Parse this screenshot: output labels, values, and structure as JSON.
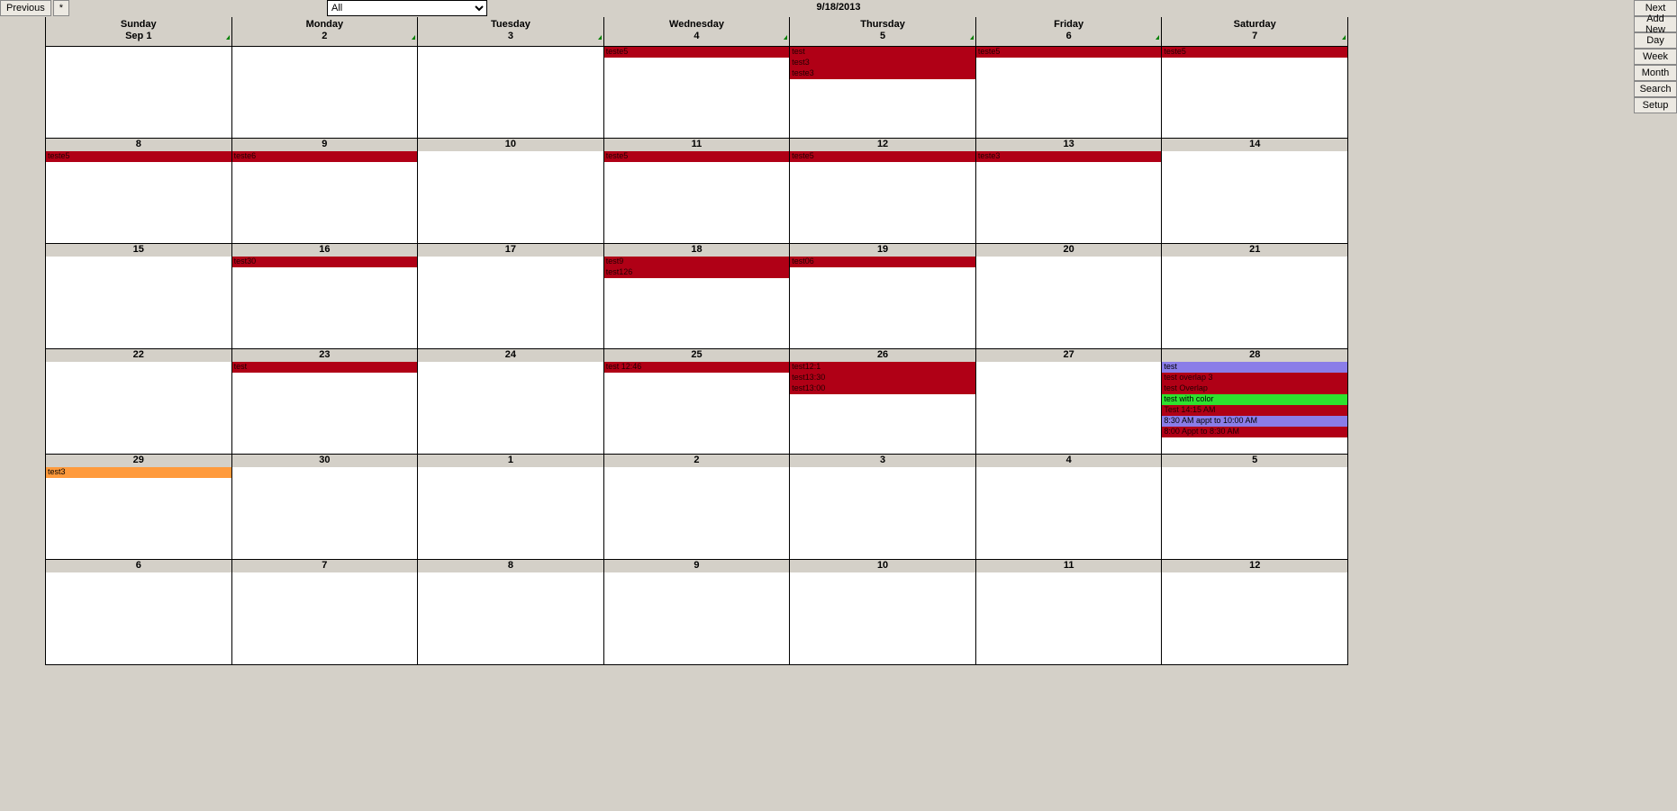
{
  "toolbar": {
    "previous": "Previous",
    "star": "*",
    "filter_selected": "All",
    "date": "9/18/2013",
    "next": "Next",
    "add_new": "Add New",
    "day": "Day",
    "week": "Week",
    "month": "Month",
    "search": "Search",
    "setup": "Setup"
  },
  "headers": [
    {
      "day": "Sunday",
      "sub": "Sep 1"
    },
    {
      "day": "Monday",
      "sub": "2"
    },
    {
      "day": "Tuesday",
      "sub": "3"
    },
    {
      "day": "Wednesday",
      "sub": "4"
    },
    {
      "day": "Thursday",
      "sub": "5"
    },
    {
      "day": "Friday",
      "sub": "6"
    },
    {
      "day": "Saturday",
      "sub": "7"
    }
  ],
  "weeks": [
    {
      "numbers": null,
      "days": [
        {
          "events": []
        },
        {
          "events": []
        },
        {
          "events": []
        },
        {
          "events": [
            {
              "text": "teste5",
              "cls": "ev-red"
            }
          ]
        },
        {
          "events": [
            {
              "text": "test",
              "cls": "ev-red"
            },
            {
              "text": "test3",
              "cls": "ev-red"
            },
            {
              "text": "teste3",
              "cls": "ev-red"
            }
          ]
        },
        {
          "events": [
            {
              "text": "teste5",
              "cls": "ev-red"
            }
          ]
        },
        {
          "events": [
            {
              "text": "teste5",
              "cls": "ev-red"
            }
          ]
        }
      ]
    },
    {
      "numbers": [
        "8",
        "9",
        "10",
        "11",
        "12",
        "13",
        "14"
      ],
      "days": [
        {
          "events": [
            {
              "text": "teste5",
              "cls": "ev-red"
            }
          ]
        },
        {
          "events": [
            {
              "text": "teste6",
              "cls": "ev-red"
            }
          ]
        },
        {
          "events": []
        },
        {
          "events": [
            {
              "text": "teste5",
              "cls": "ev-red"
            }
          ]
        },
        {
          "events": [
            {
              "text": "teste5",
              "cls": "ev-red"
            }
          ]
        },
        {
          "events": [
            {
              "text": "teste3",
              "cls": "ev-red"
            }
          ]
        },
        {
          "events": []
        }
      ]
    },
    {
      "numbers": [
        "15",
        "16",
        "17",
        "18",
        "19",
        "20",
        "21"
      ],
      "days": [
        {
          "events": []
        },
        {
          "events": [
            {
              "text": "test30",
              "cls": "ev-red"
            }
          ]
        },
        {
          "events": []
        },
        {
          "events": [
            {
              "text": "test9",
              "cls": "ev-red"
            },
            {
              "text": "test126",
              "cls": "ev-red"
            }
          ]
        },
        {
          "events": [
            {
              "text": "test06",
              "cls": "ev-red"
            }
          ]
        },
        {
          "events": []
        },
        {
          "events": []
        }
      ]
    },
    {
      "numbers": [
        "22",
        "23",
        "24",
        "25",
        "26",
        "27",
        "28"
      ],
      "days": [
        {
          "events": []
        },
        {
          "events": [
            {
              "text": "test",
              "cls": "ev-red"
            }
          ]
        },
        {
          "events": []
        },
        {
          "events": [
            {
              "text": "test 12:46",
              "cls": "ev-red"
            }
          ]
        },
        {
          "events": [
            {
              "text": "test12:1",
              "cls": "ev-red"
            },
            {
              "text": "test13:30",
              "cls": "ev-red"
            },
            {
              "text": "test13:00",
              "cls": "ev-red"
            }
          ]
        },
        {
          "events": []
        },
        {
          "events": [
            {
              "text": "test",
              "cls": "ev-purple"
            },
            {
              "text": "test overlap 3",
              "cls": "ev-red"
            },
            {
              "text": "test Overlap",
              "cls": "ev-red"
            },
            {
              "text": "test with color",
              "cls": "ev-green"
            },
            {
              "text": "Test 14:15 AM",
              "cls": "ev-red"
            },
            {
              "text": "8:30 AM appt to 10:00 AM",
              "cls": "ev-purple"
            },
            {
              "text": "8:00 Appt to 8:30 AM",
              "cls": "ev-red"
            }
          ]
        }
      ]
    },
    {
      "numbers": [
        "29",
        "30",
        "1",
        "2",
        "3",
        "4",
        "5"
      ],
      "days": [
        {
          "events": [
            {
              "text": "test3",
              "cls": "ev-orange"
            }
          ]
        },
        {
          "events": []
        },
        {
          "events": []
        },
        {
          "events": []
        },
        {
          "events": []
        },
        {
          "events": []
        },
        {
          "events": []
        }
      ]
    },
    {
      "numbers": [
        "6",
        "7",
        "8",
        "9",
        "10",
        "11",
        "12"
      ],
      "days": [
        {
          "events": []
        },
        {
          "events": []
        },
        {
          "events": []
        },
        {
          "events": []
        },
        {
          "events": []
        },
        {
          "events": []
        },
        {
          "events": []
        }
      ]
    }
  ]
}
